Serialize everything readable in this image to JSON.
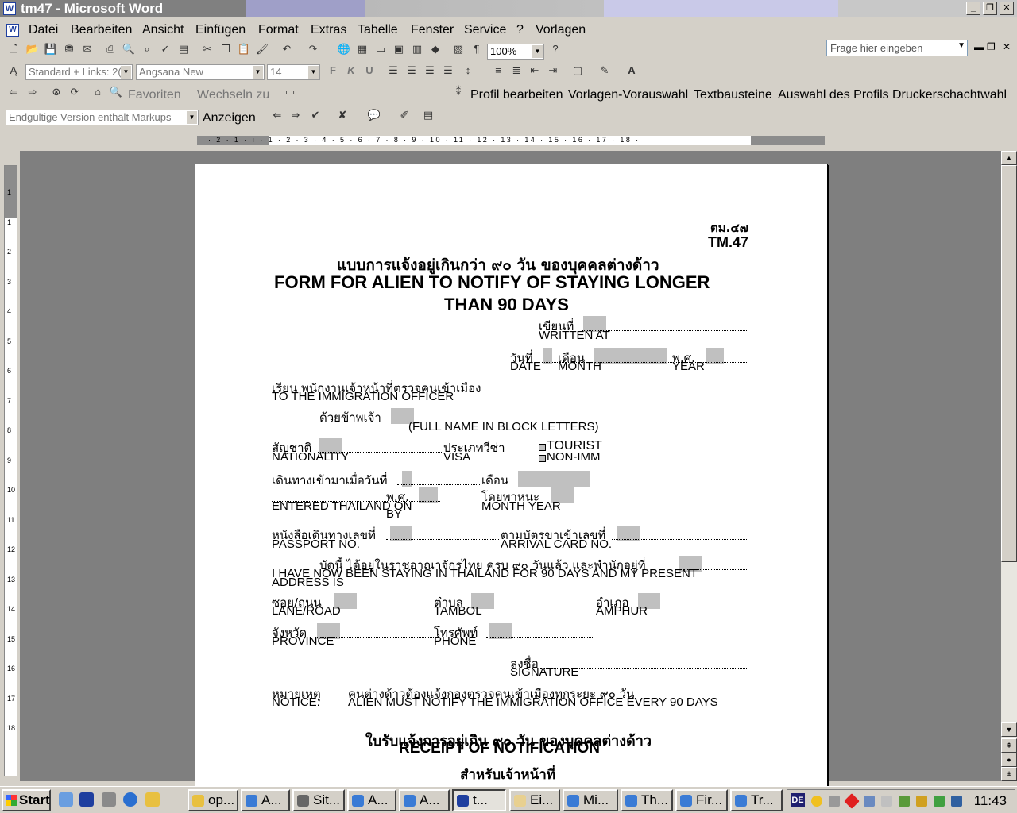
{
  "window": {
    "title": "tm47 - Microsoft Word",
    "min": "_",
    "restore": "❐",
    "close": "✕"
  },
  "menu": {
    "items": [
      "Datei",
      "Bearbeiten",
      "Ansicht",
      "Einfügen",
      "Format",
      "Extras",
      "Tabelle",
      "Fenster",
      "Service",
      "?",
      "Vorlagen"
    ],
    "help_placeholder": "Frage hier eingeben"
  },
  "toolbar": {
    "zoom": "100%",
    "style": "Standard + Links: 2(",
    "font": "Angsana New",
    "size": "14",
    "bold": "F",
    "italic": "K",
    "underline": "U",
    "favorites": "Favoriten",
    "switch": "Wechseln zu",
    "markup": "Endgültige Version enthält Markups",
    "show": "Anzeigen",
    "links": [
      "Profil bearbeiten",
      "Vorlagen-Vorauswahl",
      "Textbausteine",
      "Auswahl des Profils",
      "Druckerschachtwahl"
    ]
  },
  "ruler": {
    "numbers": "· 2 · 1 · ı · 1 · 2 · 3 · 4 · 5 · 6 · 7 · 8 · 9 · 10 · 11 · 12 · 13 · 14 · 15 · 16 · 17 · 18 ·",
    "vnumbers": [
      "1",
      "1",
      "2",
      "3",
      "4",
      "5",
      "6",
      "7",
      "8",
      "9",
      "10",
      "11",
      "12",
      "13",
      "14",
      "15",
      "16",
      "17",
      "18"
    ]
  },
  "form": {
    "code_th": "ตม.๔๗",
    "code_en": "TM.47",
    "title_th": "แบบการแจ้งอยู่เกินกว่า ๙๐ วัน ของบุคคลต่างด้าว",
    "title_en1": "FORM FOR ALIEN TO NOTIFY OF STAYING LONGER",
    "title_en2": "THAN 90 DAYS",
    "written_th": "เขียนที่",
    "written_en": "WRITTEN AT",
    "date_th": "วันที่",
    "month_th": "เดือน",
    "year_th": "พ.ศ.",
    "date_en": "DATE",
    "month_en": "MONTH",
    "year_en": "YEAR",
    "to_th": "เรียน พนักงานเจ้าหน้าที่ตรวจคนเข้าเมือง",
    "to_en": "TO     THE IMMIGRATION OFFICER",
    "name_th": "ด้วยข้าพเจ้า",
    "name_en": "(FULL NAME IN BLOCK LETTERS)",
    "nat_th": "สัญชาติ",
    "nat_en": "NATIONALITY",
    "visa_th": "ประเภทวีซ่า",
    "visa_en": "VISA",
    "tourist": "TOURIST",
    "nonimm": "NON-IMM",
    "entered_th": "เดินทางเข้ามาเมื่อวันที่",
    "entered_month_th": "เดือน",
    "entered_year_th": "พ.ศ.",
    "by_th": "โดยพาหนะ",
    "entered_en": "ENTERED THAILAND ON",
    "entered_month_en": "MONTH    YEAR",
    "by_en": "BY",
    "passport_th": "หนังสือเดินทางเลขที่",
    "passport_en": "PASSPORT NO.",
    "arrival_th": "ตามบัตรขาเข้าเลขที่",
    "arrival_en": "ARRIVAL CARD NO.",
    "stay_th": "บัดนี้ ได้อยู่ในราชอาณาจักรไทย ครบ ๙๐ วันแล้ว และพำนักอยู่ที่",
    "stay_en1": "I HAVE NOW BEEN STAYING IN THAILAND FOR 90 DAYS AND MY PRESENT",
    "stay_en2": "ADDRESS IS",
    "lane_th": "ซอย/ถนน",
    "lane_en": "LANE/ROAD",
    "tambol_th": "ตำบล",
    "tambol_en": "TAMBOL",
    "amphur_th": "อำเภอ",
    "amphur_en": "AMPHUR",
    "province_th": "จังหวัด",
    "province_en": "PROVINCE",
    "phone_th": "โทรศัพท์",
    "phone_en": "PHONE",
    "sign_th": "ลงชื่อ",
    "sign_en": "SIGNATURE",
    "notice_th": "หมายเหตุ",
    "notice_text_th": "คนต่างด้าวต้องแจ้งกองตรวจคนเข้าเมืองทุกระยะ ๙๐ วัน",
    "notice_en": "NOTICE:",
    "notice_text_en": "ALIEN MUST NOTIFY THE IMMIGRATION OFFICE EVERY 90 DAYS",
    "receipt_th": "ใบรับแจ้งการอยู่เกิน ๙๐ วัน ของบุคคลต่างด้าว",
    "receipt_en": "RECEIPT OF NOTIFICATION",
    "officer_th": "สำหรับเจ้าหน้าที่"
  },
  "taskbar": {
    "start": "Start",
    "tasks": [
      "op...",
      "A...",
      "Sit...",
      "A...",
      "A...",
      "t...",
      "Ei...",
      "Mi...",
      "Th...",
      "Fir...",
      "Tr..."
    ],
    "lang": "DE",
    "time": "11:43"
  }
}
